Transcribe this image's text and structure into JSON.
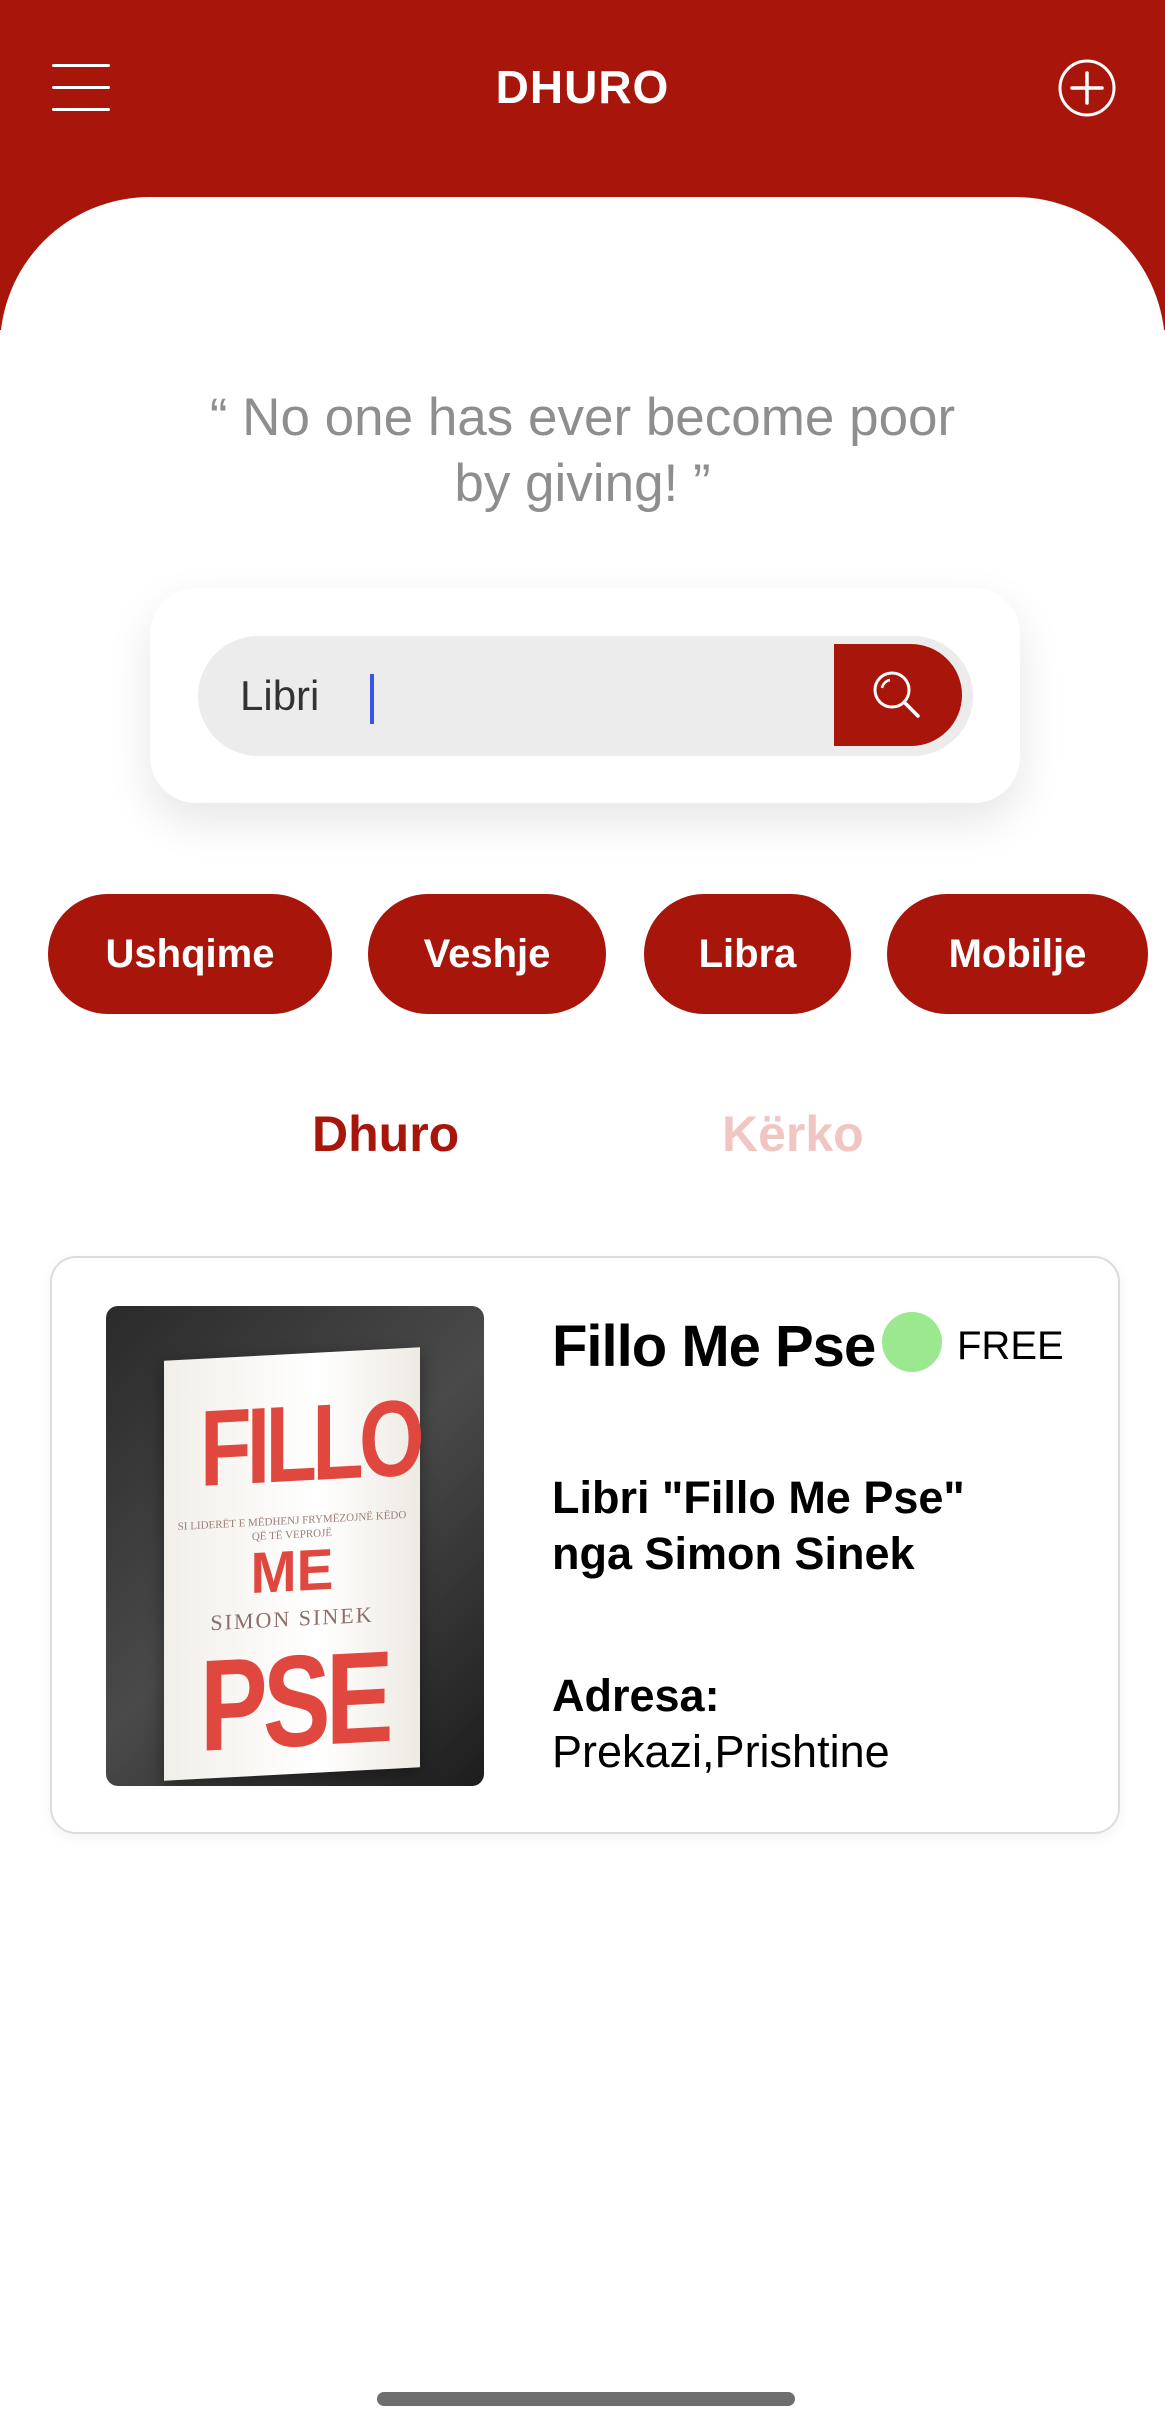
{
  "header": {
    "title": "DHURO",
    "menu_icon": "hamburger-menu-icon",
    "add_icon": "plus-circle-icon",
    "background_color": "#a8150b"
  },
  "quote": "“ No one has ever become poor by giving! ”",
  "search": {
    "value": "Libri",
    "button_icon": "search-icon"
  },
  "categories": [
    "Ushqime",
    "Veshje",
    "Libra",
    "Mobilje"
  ],
  "tabs": [
    {
      "label": "Dhuro",
      "active": true
    },
    {
      "label": "Kërko",
      "active": false
    }
  ],
  "listing": {
    "image_text": {
      "line1": "FILLO",
      "subtitle": "SI LIDERËT E MËDHENJ FRYMËZOJNË KËDO QË TË VEPROJË",
      "line2": "ME",
      "author": "SIMON SINEK",
      "line3": "PSE"
    },
    "title": "Fillo Me Pse",
    "status_color": "#9be88f",
    "price": "FREE",
    "description": "Libri \"Fillo Me Pse\" nga Simon Sinek",
    "address_label": "Adresa:",
    "address_value": "Prekazi,Prishtine"
  },
  "colors": {
    "accent": "#a8150b",
    "tab_inactive": "#f0c6c3",
    "card_border": "#dcdcdc"
  }
}
